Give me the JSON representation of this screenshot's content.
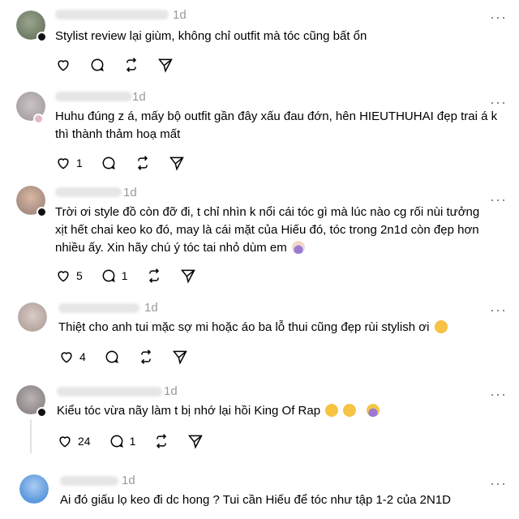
{
  "icons": {
    "like": "heart-icon",
    "reply": "comment-icon",
    "repost": "repost-icon",
    "share": "send-icon",
    "more": "more-icon"
  },
  "colors": {
    "text": "#000000",
    "muted": "#999999",
    "divider": "#eeeeee"
  },
  "replies": [
    {
      "time": "1d",
      "text": "Stylist review lại giùm, không chỉ outfit mà tóc cũng bất ổn",
      "like_count": "",
      "reply_count": ""
    },
    {
      "time": "1d",
      "text": "Huhu đúng z á, mấy bộ outfit gần đây xấu đau đớn, hên HIEUTHUHAI đẹp trai á k thì thành thảm hoạ mất",
      "like_count": "1",
      "reply_count": ""
    },
    {
      "time": "1d",
      "text": "Trời ơi style đồ còn đỡ đi, t chỉ nhìn k nổi cái tóc gì mà lúc nào cg rối nùi tưởng xịt hết chai keo ko đó, may là cái mặt của Hiếu đó, tóc trong 2n1d còn đẹp hơn nhiều ấy. Xin hãy chú ý tóc tai nhỏ dùm em",
      "like_count": "5",
      "reply_count": "1"
    },
    {
      "time": "1d",
      "text": "Thiệt cho anh tui mặc sợ mi hoặc áo ba lỗ thui cũng đẹp rùi stylish ơi",
      "like_count": "4",
      "reply_count": ""
    },
    {
      "time": "1d",
      "text": "Kiểu tóc vừa nãy làm t bị nhớ lại hồi King Of Rap",
      "like_count": "24",
      "reply_count": "1"
    },
    {
      "time": "1d",
      "text": "Ai đó giấu lọ keo đi dc hong ? Tui cần Hiếu để tóc như tập 1-2 của 2N1D",
      "like_count": "",
      "reply_count": ""
    }
  ]
}
